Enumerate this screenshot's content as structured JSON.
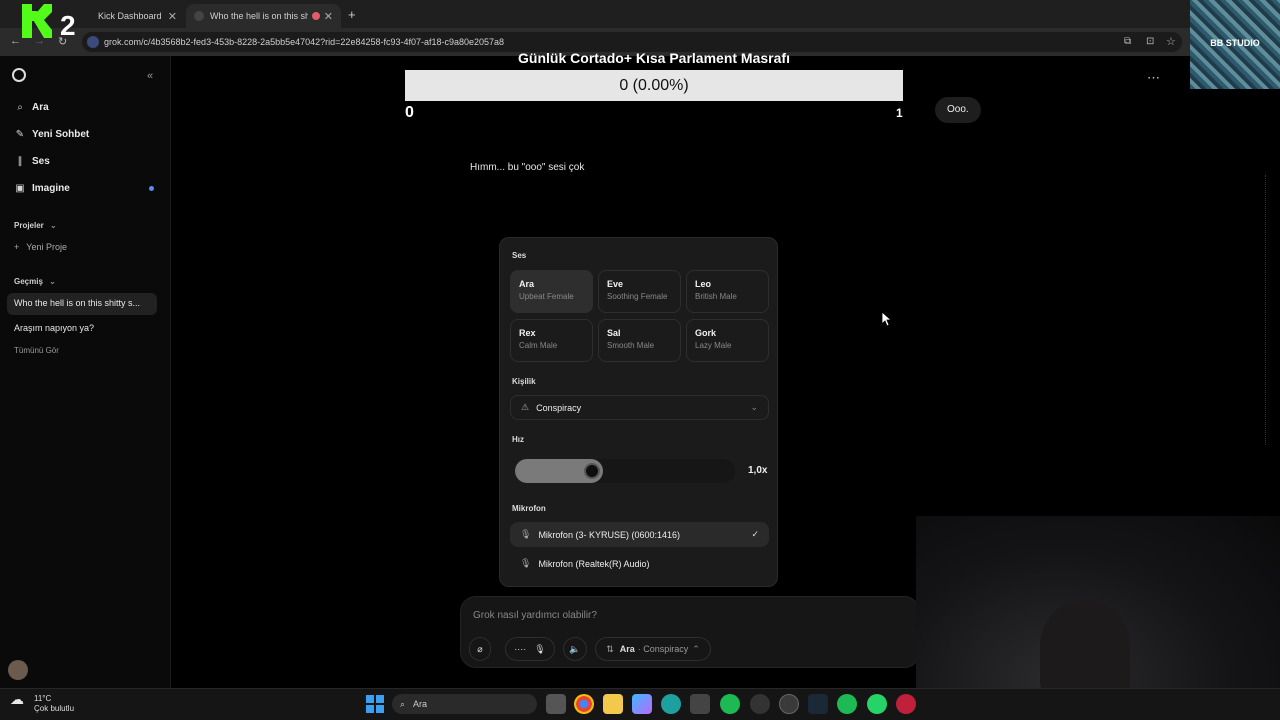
{
  "browser": {
    "tabs": [
      {
        "label": "Kick Dashboard"
      },
      {
        "label": "Who the hell is on this shitty"
      }
    ],
    "new_tab": "+",
    "url": "grok.com/c/4b3568b2-fed3-453b-8228-2a5bb5e47042?rid=22e84258-fc93-4f07-af18-c9a80e2057a8"
  },
  "sidebar": {
    "items": [
      {
        "label": "Ara",
        "icon": "search-icon"
      },
      {
        "label": "Yeni Sohbet",
        "icon": "edit-icon"
      },
      {
        "label": "Ses",
        "icon": "waveform-icon"
      },
      {
        "label": "Imagine",
        "icon": "image-icon"
      }
    ],
    "projects_label": "Projeler",
    "new_project": "Yeni Proje",
    "history_label": "Geçmiş",
    "history": [
      {
        "label": "Who the hell is on this shitty s..."
      },
      {
        "label": "Araşım napıyon ya?"
      }
    ],
    "see_all": "Tümünü Gör"
  },
  "overlay": {
    "title": "Günlük Cortado+ Kısa Parlament Masrafı",
    "value": "0 (0.00%)",
    "min": "0",
    "max": "1"
  },
  "chat": {
    "user_message": "Ooo.",
    "assistant_message": "Hımm... bu \"ooo\" sesi çok"
  },
  "voice_panel": {
    "voice_label": "Ses",
    "voices": [
      {
        "name": "Ara",
        "desc": "Upbeat Female",
        "selected": true
      },
      {
        "name": "Eve",
        "desc": "Soothing Female"
      },
      {
        "name": "Leo",
        "desc": "British Male"
      },
      {
        "name": "Rex",
        "desc": "Calm Male"
      },
      {
        "name": "Sal",
        "desc": "Smooth Male"
      },
      {
        "name": "Gork",
        "desc": "Lazy Male"
      }
    ],
    "personality_label": "Kişilik",
    "personality_value": "Conspiracy",
    "speed_label": "Hız",
    "speed_value": "1,0x",
    "mic_label": "Mikrofon",
    "mics": [
      {
        "name": "Mikrofon (3- KYRUSE) (0600:1416)",
        "selected": true
      },
      {
        "name": "Mikrofon (Realtek(R) Audio)"
      }
    ]
  },
  "composer": {
    "placeholder": "Grok nasıl yardımcı olabilir?",
    "voice_name": "Ara",
    "persona": "· Conspiracy"
  },
  "taskbar": {
    "weather_temp": "11°C",
    "weather_desc": "Çok bulutlu",
    "search": "Ara"
  },
  "watermark": "BB STUDIO",
  "colors": {
    "accent": "#5b8def",
    "kick_green": "#53fc18"
  }
}
